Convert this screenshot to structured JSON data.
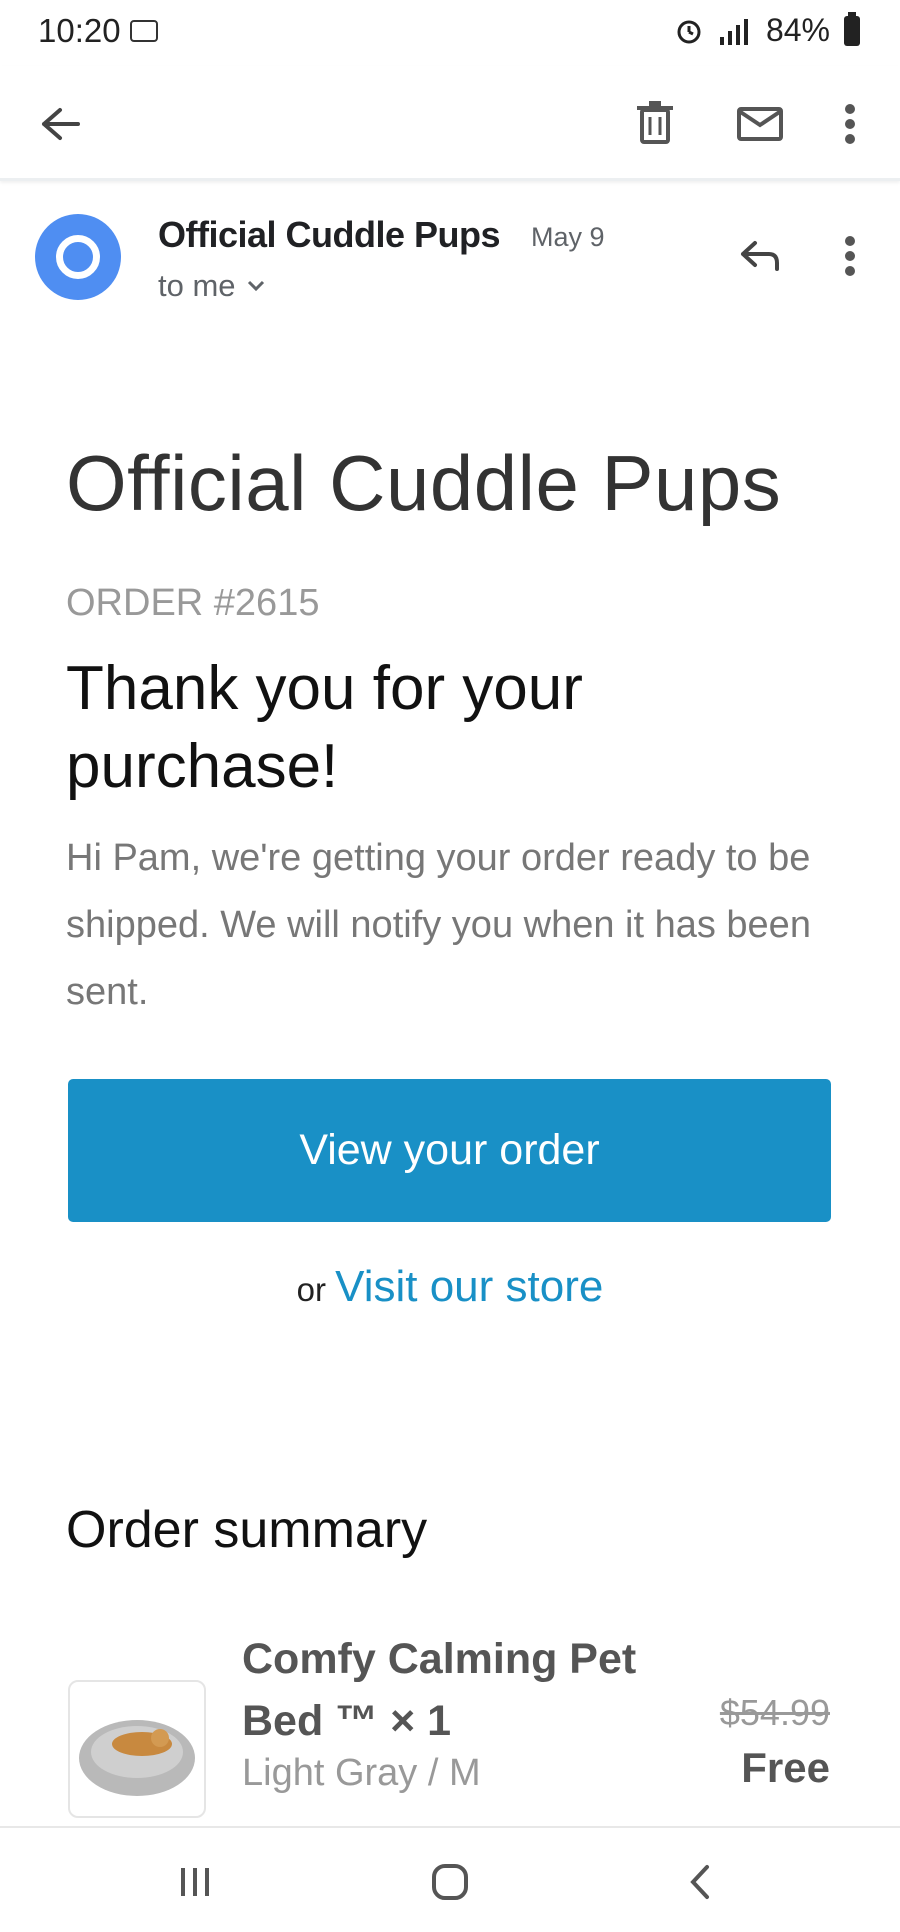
{
  "status_bar": {
    "time": "10:20",
    "battery": "84%"
  },
  "email": {
    "sender": "Official Cuddle Pups",
    "date": "May 9",
    "recipient": "to me"
  },
  "content": {
    "store_title": "Official Cuddle Pups",
    "order_number": "ORDER #2615",
    "headline": "Thank you for your purchase!",
    "message": "Hi Pam, we're getting your order ready to be shipped. We will notify you when it has been sent.",
    "cta_label": "View your order",
    "or_text": "or",
    "store_link": "Visit our store",
    "summary_title": "Order summary"
  },
  "order_items": [
    {
      "name": "Comfy Calming Pet Bed ™ × 1",
      "variant": "Light Gray / M",
      "original_price": "$54.99",
      "price": "Free"
    }
  ],
  "icons": [
    "back-arrow-icon",
    "delete-icon",
    "mail-icon",
    "more-vert-icon",
    "reply-icon",
    "chevron-down-icon",
    "recents-icon",
    "home-icon",
    "nav-back-icon"
  ]
}
